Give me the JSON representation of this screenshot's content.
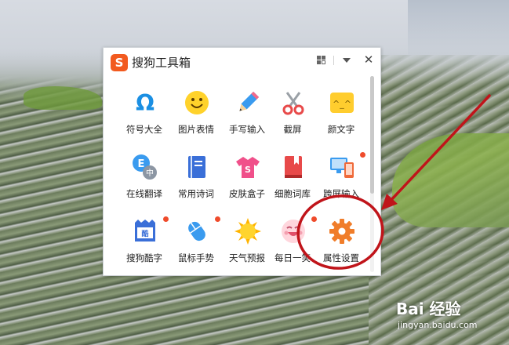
{
  "window": {
    "title": "搜狗工具箱",
    "logo_letter": "S",
    "accent_color": "#f25a1f"
  },
  "titlebar_icons": [
    "grid-icon",
    "dropdown-icon",
    "close-icon"
  ],
  "close_glyph": "✕",
  "tools": [
    {
      "label": "符号大全",
      "icon": "omega-symbol-icon",
      "color": "#1a8fe3",
      "badge": false
    },
    {
      "label": "图片表情",
      "icon": "smiley-face-icon",
      "color": "#ffd22b",
      "badge": false
    },
    {
      "label": "手写输入",
      "icon": "pencil-icon",
      "color": "#3a9bef",
      "badge": false
    },
    {
      "label": "截屏",
      "icon": "scissors-icon",
      "color": "#e84a4a",
      "badge": false
    },
    {
      "label": "颜文字",
      "icon": "kaomoji-icon",
      "color": "#ffcd2e",
      "badge": false
    },
    {
      "label": "在线翻译",
      "icon": "translate-icon",
      "color": "#3a9bef",
      "badge": false
    },
    {
      "label": "常用诗词",
      "icon": "book-icon",
      "color": "#3a6fd8",
      "badge": false
    },
    {
      "label": "皮肤盒子",
      "icon": "tshirt-icon",
      "color": "#f0508a",
      "badge": false
    },
    {
      "label": "细胞词库",
      "icon": "bookmark-book-icon",
      "color": "#e84a4a",
      "badge": false
    },
    {
      "label": "跨屏输入",
      "icon": "cross-screen-icon",
      "color": "#3a9bef",
      "badge": true
    },
    {
      "label": "搜狗酷字",
      "icon": "cool-font-icon",
      "color": "#3a6fd8",
      "badge": true
    },
    {
      "label": "鼠标手势",
      "icon": "mouse-icon",
      "color": "#3a9bef",
      "badge": true
    },
    {
      "label": "天气预报",
      "icon": "sun-icon",
      "color": "#ffb400",
      "badge": false
    },
    {
      "label": "每日一笑",
      "icon": "laughing-face-icon",
      "color": "#f4a0b0",
      "badge": true
    },
    {
      "label": "属性设置",
      "icon": "gear-icon",
      "color": "#f07d2a",
      "badge": false
    }
  ],
  "annotation": {
    "color": "#c0141a",
    "target": "属性设置"
  },
  "watermark": {
    "logo": "Bai 经验",
    "url": "jingyan.baidu.com"
  }
}
